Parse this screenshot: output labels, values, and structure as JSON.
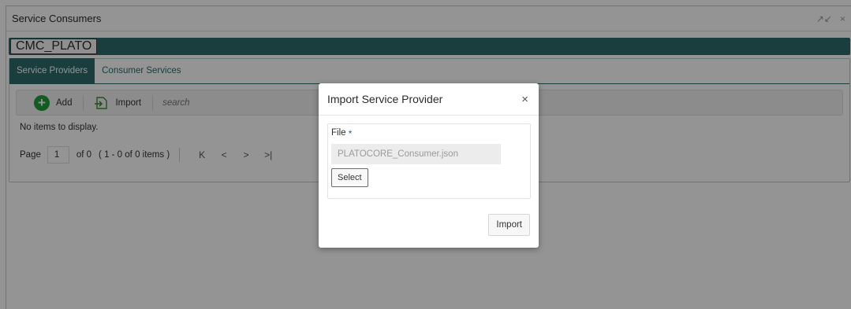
{
  "window": {
    "title": "Service Consumers",
    "controls": {
      "minimize_icon": "minimize-icon",
      "close_icon": "close-icon",
      "minimize_glyph": "↗↙",
      "close_glyph": "×"
    }
  },
  "consumer": {
    "name": "CMC_PLATO"
  },
  "tabs": [
    {
      "label": "Service Providers",
      "active": true
    },
    {
      "label": "Consumer Services",
      "active": false
    }
  ],
  "toolbar": {
    "add_label": "Add",
    "import_label": "Import",
    "search_placeholder": "search"
  },
  "table": {
    "empty_message": "No items to display."
  },
  "pager": {
    "page_label": "Page",
    "page_value": "1",
    "of_label": "of 0",
    "range_text": "( 1 - 0 of 0 items )",
    "first": "K",
    "prev": "<",
    "next": ">",
    "last": ">|"
  },
  "dialog": {
    "title": "Import Service Provider",
    "close_glyph": "×",
    "file_label": "File",
    "required_mark": "*",
    "file_value": "PLATOCORE_Consumer.json",
    "select_label": "Select",
    "import_label": "Import"
  },
  "colors": {
    "accent": "#2d6a6c",
    "add_green": "#1f9d3a",
    "required_blue": "#1e63b6"
  }
}
